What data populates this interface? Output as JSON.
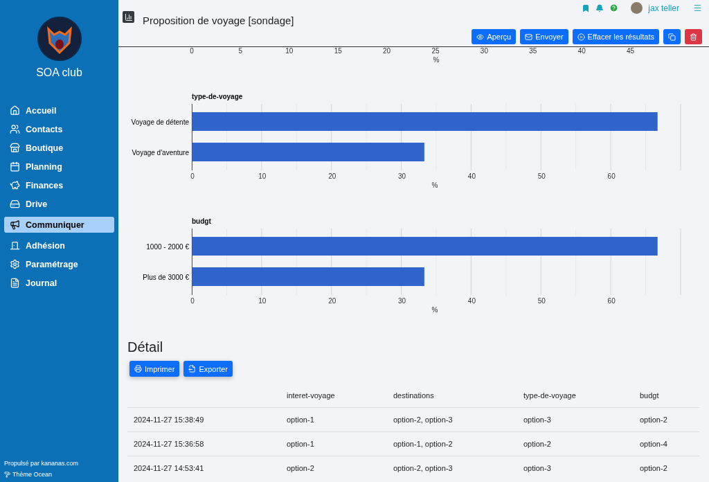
{
  "sidebar": {
    "club_name": "SOA club",
    "items": [
      {
        "label": "Accueil",
        "selected": false
      },
      {
        "label": "Contacts",
        "selected": false
      },
      {
        "label": "Boutique",
        "selected": false
      },
      {
        "label": "Planning",
        "selected": false
      },
      {
        "label": "Finances",
        "selected": false
      },
      {
        "label": "Drive",
        "selected": false
      },
      {
        "label": "Communiquer",
        "selected": true
      },
      {
        "label": "Adhésion",
        "selected": false
      },
      {
        "label": "Paramétrage",
        "selected": false
      },
      {
        "label": "Journal",
        "selected": false
      }
    ],
    "footer": {
      "powered_by": "Propulsé par kananas.com",
      "theme": "Thème Ocean"
    }
  },
  "topbar": {
    "user": "jax teller"
  },
  "header": {
    "title": "Proposition de voyage [sondage]",
    "actions": [
      {
        "label": "Aperçu",
        "kind": "primary"
      },
      {
        "label": "Envoyer",
        "kind": "primary"
      },
      {
        "label": "Effacer les résultats",
        "kind": "primary"
      },
      {
        "kind": "primary"
      },
      {
        "kind": "danger"
      }
    ]
  },
  "top_axis": {
    "ticks": [
      "0",
      "5",
      "10",
      "15",
      "20",
      "25",
      "30",
      "35",
      "40",
      "45"
    ],
    "xlabel": "%"
  },
  "charts": [
    {
      "chart_data": {
        "type": "bar",
        "orientation": "horizontal",
        "title": "type-de-voyage",
        "xlabel": "%",
        "grid": true,
        "categories": [
          "Voyage de détente",
          "Voyage d'aventure"
        ],
        "series": [
          {
            "color": "#3066cc",
            "values": [
              66.7,
              33.3
            ]
          }
        ],
        "xlim": [
          0,
          70
        ],
        "xticks": [
          0,
          10,
          20,
          30,
          40,
          50,
          60
        ]
      }
    },
    {
      "chart_data": {
        "type": "bar",
        "orientation": "horizontal",
        "title": "budgt",
        "xlabel": "%",
        "grid": true,
        "categories": [
          "1000 - 2000 €",
          "Plus de 3000 €"
        ],
        "series": [
          {
            "color": "#3066cc",
            "values": [
              66.7,
              33.3
            ]
          }
        ],
        "xlim": [
          0,
          70
        ],
        "xticks": [
          0,
          10,
          20,
          30,
          40,
          50,
          60
        ]
      }
    }
  ],
  "detail": {
    "title": "Détail",
    "buttons": [
      {
        "label": "Imprimer"
      },
      {
        "label": "Exporter"
      }
    ],
    "columns": [
      "",
      "interet-voyage",
      "destinations",
      "type-de-voyage",
      "budgt"
    ],
    "rows": [
      [
        "2024-11-27 15:38:49",
        "option-1",
        "option-2, option-3",
        "option-3",
        "option-2"
      ],
      [
        "2024-11-27 15:36:58",
        "option-1",
        "option-1, option-2",
        "option-2",
        "option-4"
      ],
      [
        "2024-11-27 14:53:41",
        "option-2",
        "option-2, option-3",
        "option-3",
        "option-2"
      ]
    ]
  }
}
